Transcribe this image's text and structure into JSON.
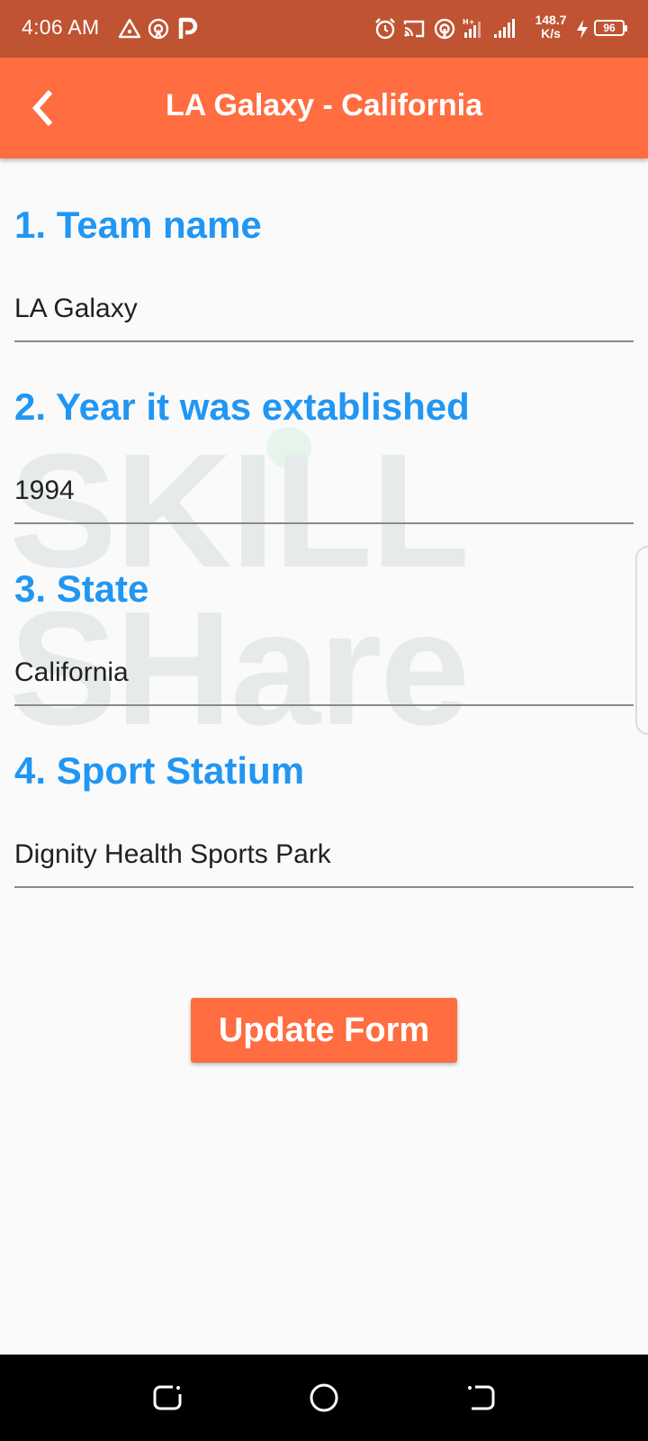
{
  "status_bar": {
    "time": "4:06 AM",
    "net_speed_value": "148.7",
    "net_speed_unit": "K/s",
    "battery": "96",
    "background_color": "#bf5332"
  },
  "app_bar": {
    "title": "LA Galaxy - California",
    "background_color": "#ff6d40",
    "back_icon": "chevron-left-icon"
  },
  "watermark": {
    "line1": "SKILL",
    "line2": "SHare"
  },
  "form": {
    "fields": [
      {
        "label": "1. Team name",
        "value": "LA Galaxy"
      },
      {
        "label": "2. Year it was extablished",
        "value": "1994"
      },
      {
        "label": "3. State",
        "value": "California"
      },
      {
        "label": "4. Sport Statium",
        "value": "Dignity Health Sports Park"
      }
    ],
    "label_color": "#2196f3"
  },
  "actions": {
    "update_label": "Update Form",
    "button_color": "#ff6d40"
  },
  "nav_bar": {
    "icons": [
      "recent-apps-icon",
      "home-icon",
      "back-icon"
    ]
  }
}
